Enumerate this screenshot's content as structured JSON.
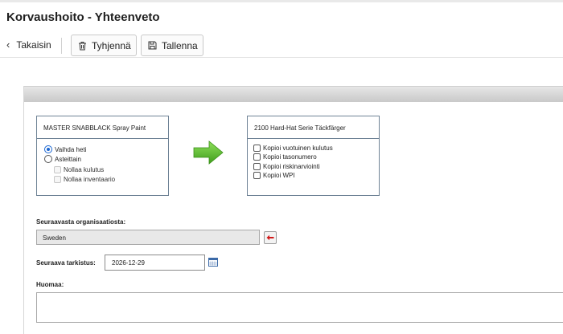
{
  "header": {
    "title": "Korvaushoito - Yhteenveto"
  },
  "toolbar": {
    "back_label": "Takaisin",
    "clear_label": "Tyhjennä",
    "save_label": "Tallenna"
  },
  "source_box": {
    "title": "MASTER SNABBLACK Spray Paint",
    "options": {
      "replace_now": {
        "label": "Vaihda heti",
        "selected": true
      },
      "gradually": {
        "label": "Asteittain",
        "selected": false
      },
      "reset_consumption": {
        "label": "Nollaa kulutus",
        "checked": false,
        "disabled": true
      },
      "reset_inventory": {
        "label": "Nollaa inventaario",
        "checked": false,
        "disabled": true
      }
    }
  },
  "target_box": {
    "title": "2100 Hard-Hat Serie Täckfärger",
    "options": {
      "copy_annual": {
        "label": "Kopioi vuotuinen kulutus",
        "checked": false
      },
      "copy_level": {
        "label": "Kopioi tasonumero",
        "checked": false
      },
      "copy_risk": {
        "label": "Kopioi riskinarviointi",
        "checked": false
      },
      "copy_wpi": {
        "label": "Kopioi WPI",
        "checked": false
      }
    }
  },
  "form": {
    "org_label": "Seuraavasta organisaatiosta:",
    "org_value": "Sweden",
    "next_check_label": "Seuraava tarkistus:",
    "next_check_value": "2026-12-29",
    "notes_label": "Huomaa:",
    "notes_value": ""
  },
  "colors": {
    "arrow_green": "#5cbf2a",
    "box_border": "#6f8396",
    "radio_selected": "#1a66d2",
    "org_button_arrow": "#d11a1a"
  },
  "icons": {
    "back": "chevron-left-icon",
    "clear": "trash-icon",
    "save": "floppy-disk-icon",
    "arrow": "arrow-right-icon",
    "org_button": "arrow-left-icon",
    "date": "calendar-icon"
  }
}
